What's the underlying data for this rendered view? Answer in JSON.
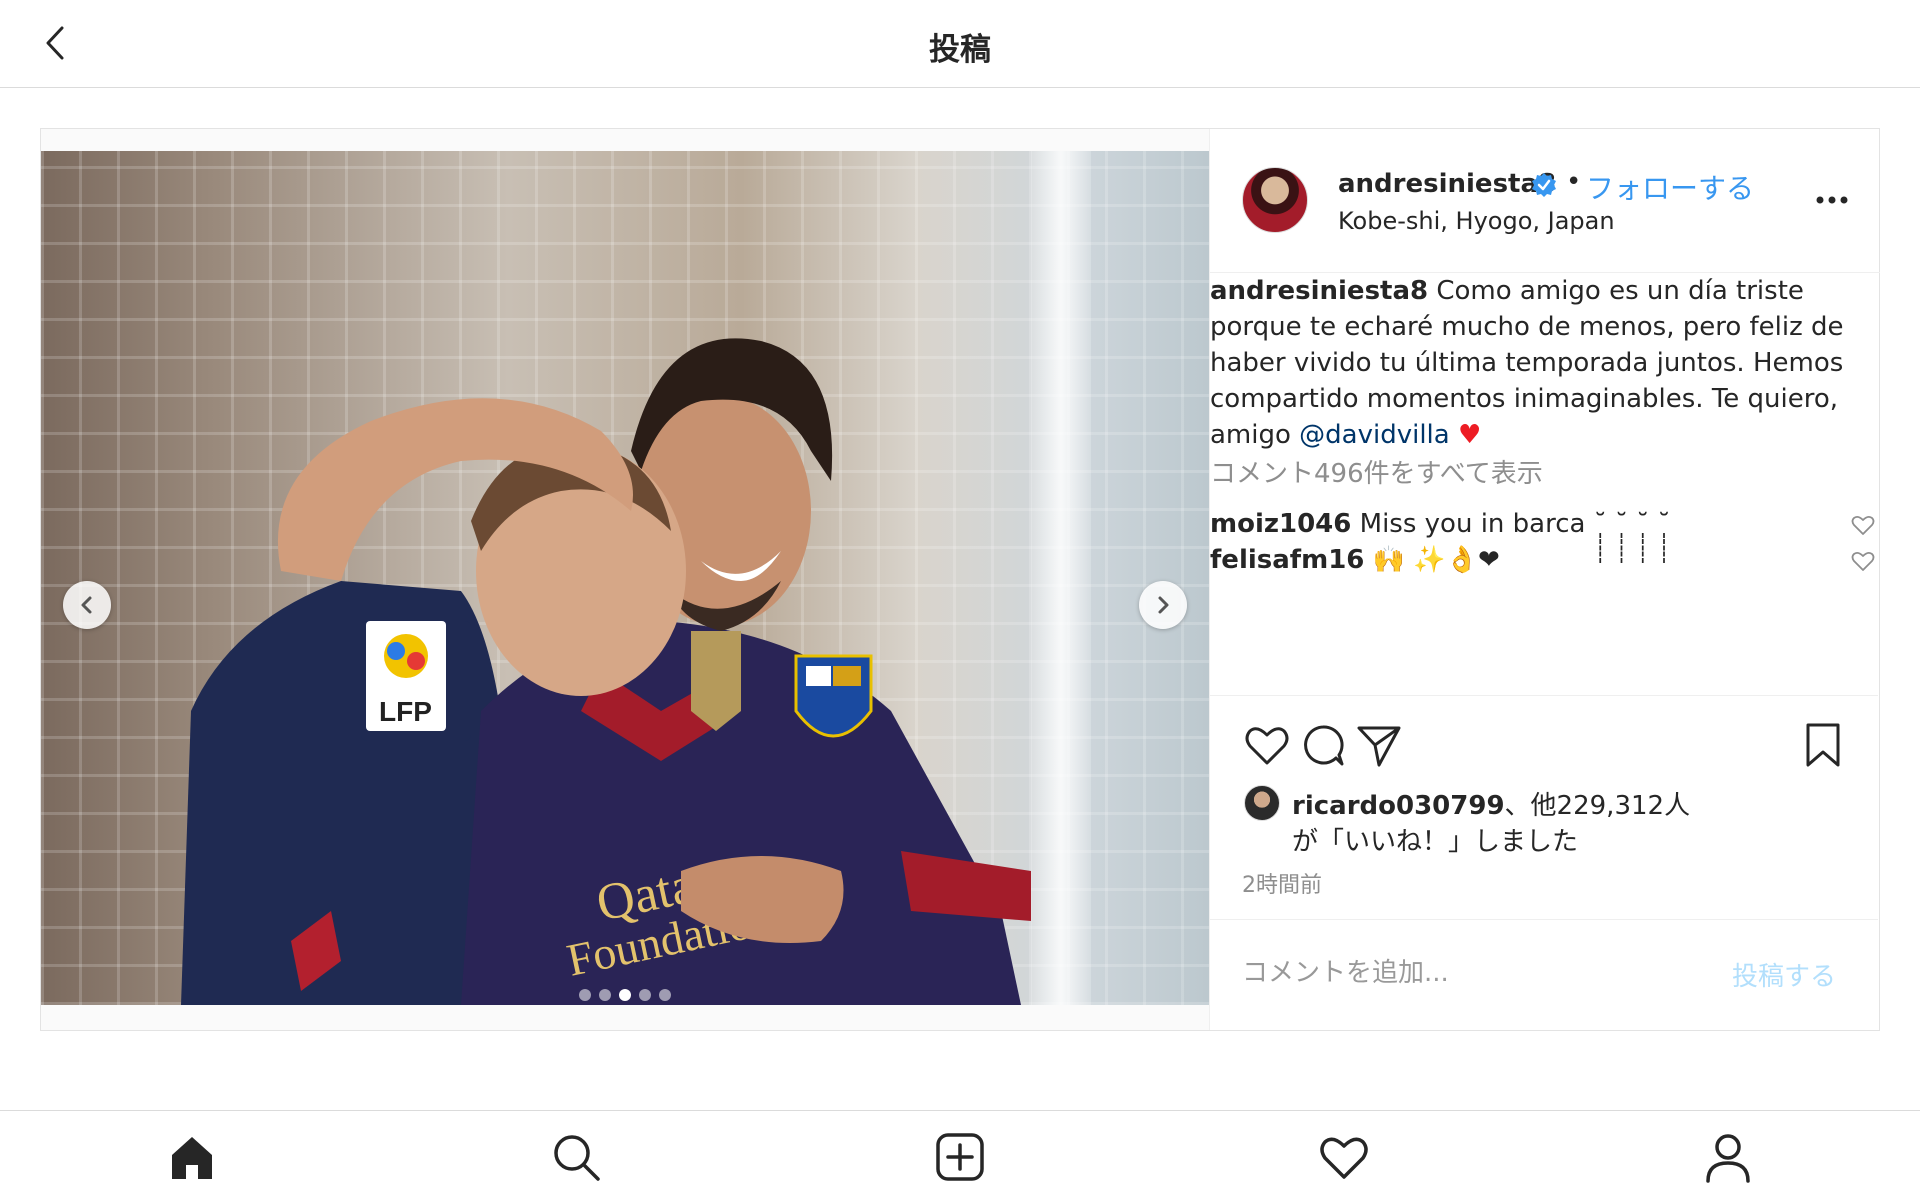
{
  "header": {
    "title": "投稿",
    "back_icon": "chevron-left-icon"
  },
  "post": {
    "username": "andresiniesta8",
    "verified_icon": "verified-badge-icon",
    "separator": "•",
    "follow_label": "フォローする",
    "location": "Kobe-shi, Hyogo, Japan",
    "more_icon": "more-options-icon",
    "media": {
      "carousel_count": 5,
      "active_index": 2
    },
    "caption": {
      "user": "andresiniesta8",
      "text": " Como amigo es un día triste porque te echaré mucho de menos, pero feliz de haber vivido tu última temporada juntos. Hemos compartido momentos inimaginables. Te quiero, amigo ",
      "mention": "@davidvilla",
      "emoji": " ♥"
    },
    "view_all_comments": "コメント496件をすべて表示",
    "comments": [
      {
        "user": "moiz1046",
        "text": " Miss you in barca ˘̩̩̩̩̩ ˘̩̩̩̩̩ ˘̩̩̩̩̩ ˘̩̩̩̩̩"
      },
      {
        "user": "felisafm16",
        "text": " 🙌 ✨👌❤"
      }
    ],
    "likes": {
      "user": "ricardo030799",
      "suffix": "、他229,312人",
      "line2": "が「いいね！」しました"
    },
    "timestamp": "2時間前",
    "comment_placeholder": "コメントを追加...",
    "post_button": "投稿する"
  },
  "colors": {
    "link_blue": "#3897f0",
    "mention_blue": "#003569",
    "muted": "#8e8e8e",
    "post_button_disabled": "#b2dffc"
  }
}
